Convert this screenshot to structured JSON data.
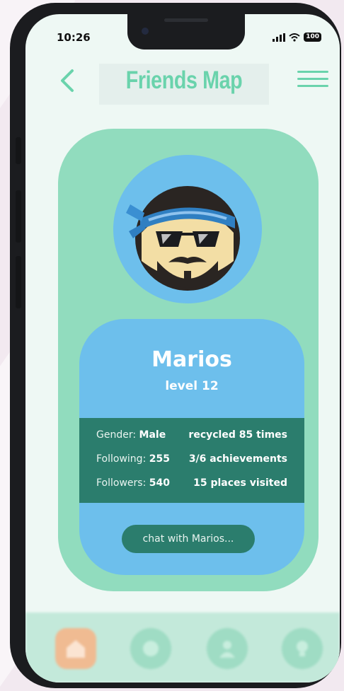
{
  "status_bar": {
    "time": "10:26",
    "battery": "100"
  },
  "header": {
    "title": "Friends Map"
  },
  "profile": {
    "name": "Marios",
    "level": "level 12",
    "stats": [
      {
        "key": "Gender: ",
        "value": "Male",
        "right": "recycled 85 times"
      },
      {
        "key": "Following: ",
        "value": "255",
        "right": "3/6 achievements"
      },
      {
        "key": "Followers: ",
        "value": "540",
        "right": "15 places visited"
      }
    ],
    "chat_button": "chat with Marios..."
  },
  "tabs": [
    {
      "icon": "home-icon"
    },
    {
      "icon": "map-icon"
    },
    {
      "icon": "profile-icon"
    },
    {
      "icon": "lightbulb-icon"
    }
  ],
  "colors": {
    "accent": "#6ad3ac",
    "card_outer": "#91dcbe",
    "card_inner": "#6dbfec",
    "stats_band": "#2b7d6d",
    "home_tab": "#f0bb92"
  }
}
